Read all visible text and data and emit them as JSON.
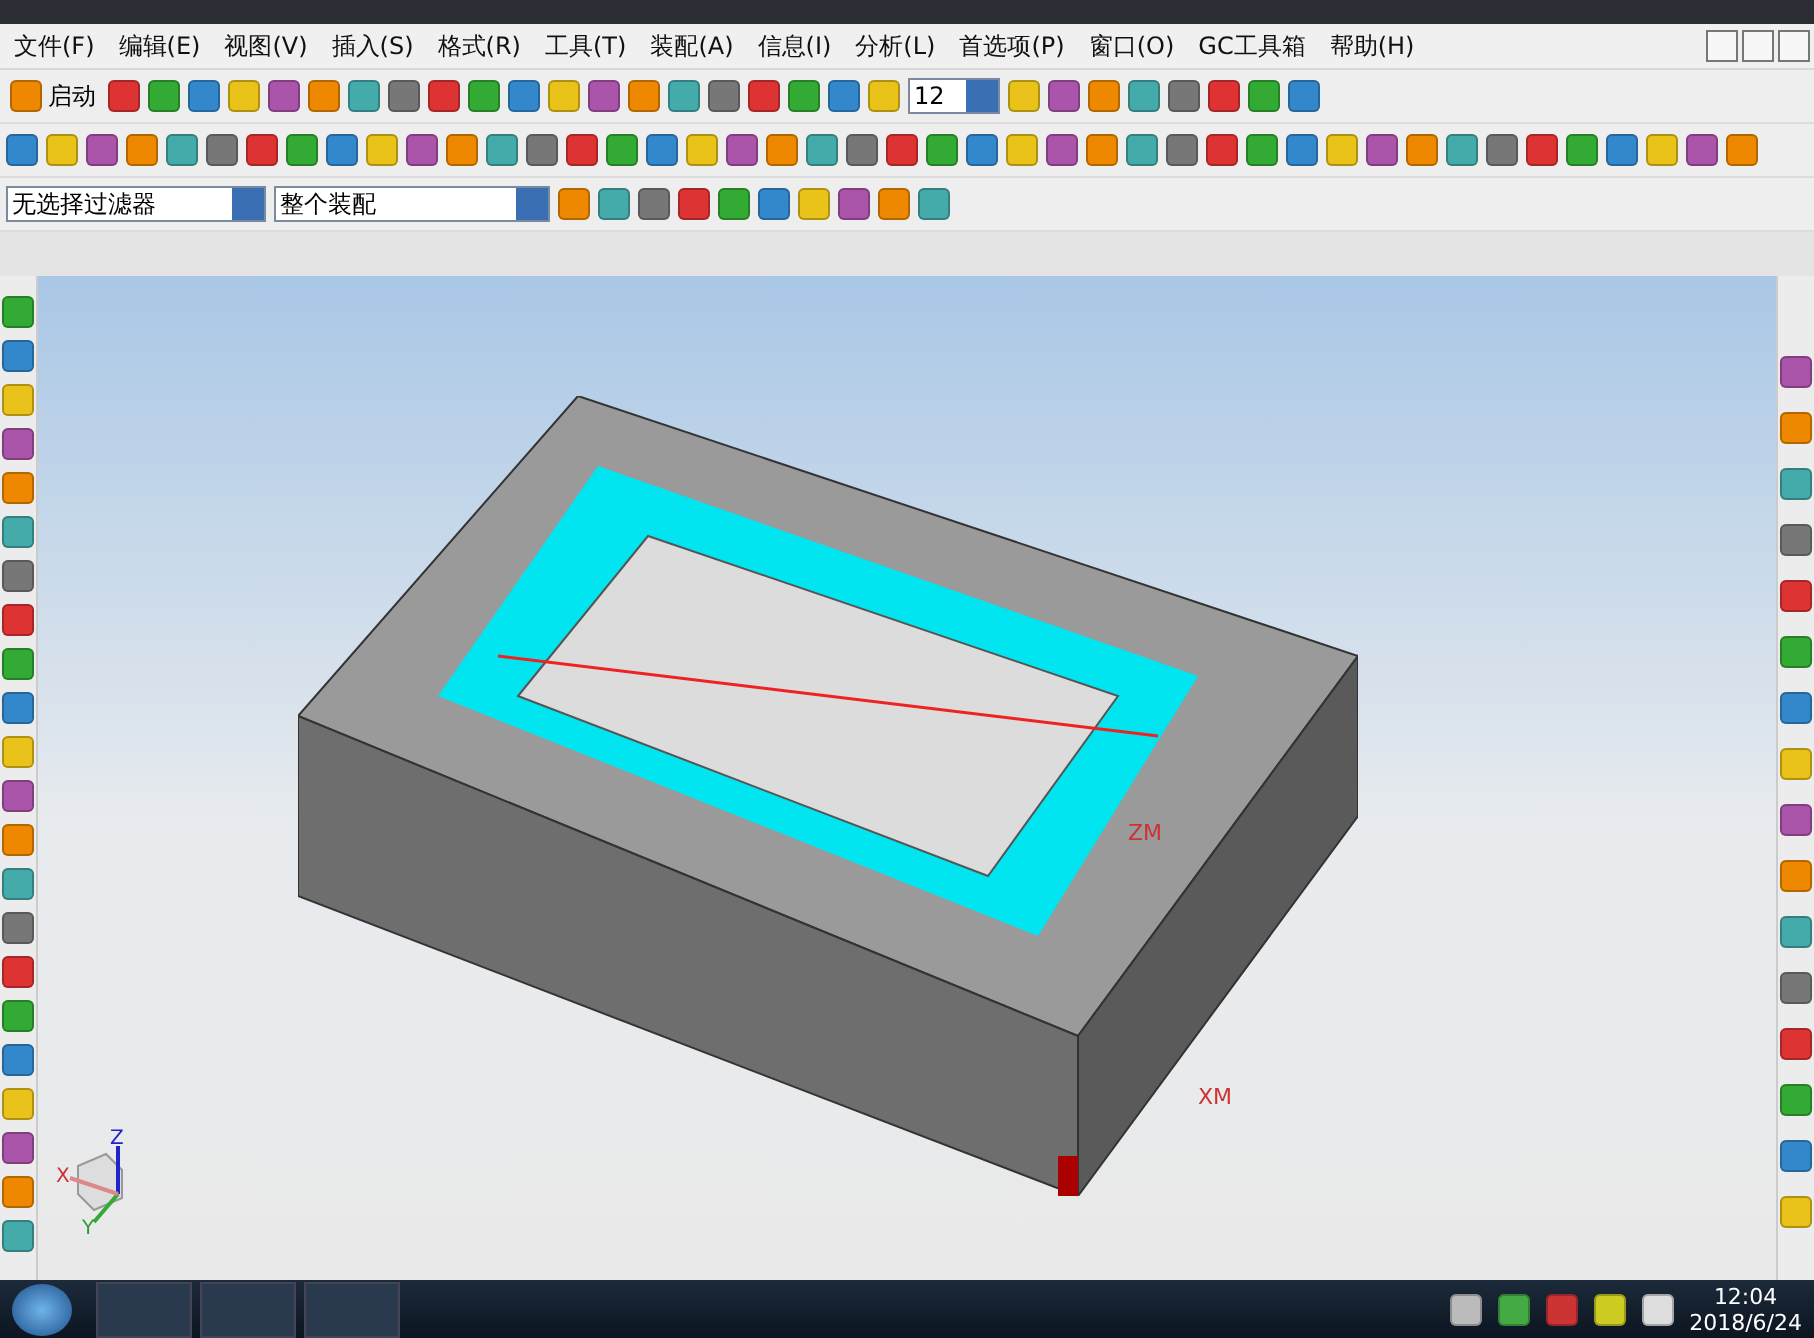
{
  "menu": [
    "文件(F)",
    "编辑(E)",
    "视图(V)",
    "插入(S)",
    "格式(R)",
    "工具(T)",
    "装配(A)",
    "信息(I)",
    "分析(L)",
    "首选项(P)",
    "窗口(O)",
    "GC工具箱",
    "帮助(H)"
  ],
  "toolbar": {
    "start_label": "启动",
    "font_size": "12",
    "filter": "无选择过滤器",
    "scope": "整个装配"
  },
  "viewport": {
    "axis_labels": [
      "ZM",
      "XM"
    ],
    "triad": [
      "X",
      "Y",
      "Z"
    ]
  },
  "taskbar": {
    "time": "12:04",
    "date": "2018/6/24"
  }
}
